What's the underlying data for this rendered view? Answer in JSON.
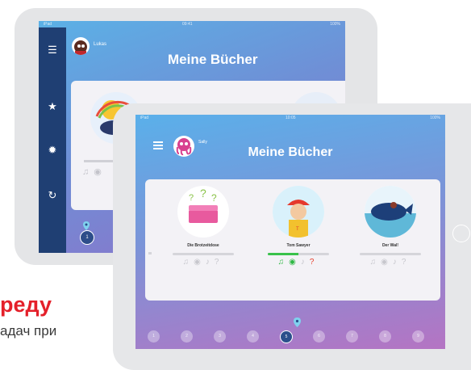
{
  "back": {
    "status_time": "09:41",
    "status_left": "iPad",
    "status_right": "100%",
    "username": "Lukas",
    "title": "Meine Bücher",
    "page_dot": "1"
  },
  "front": {
    "status_left": "iPad",
    "status_time": "10:05",
    "status_right": "100%",
    "username": "Sally",
    "title": "Meine Bücher",
    "books": [
      {
        "title": "Die Brotzeitdose",
        "progress": 0
      },
      {
        "title": "Tom Sawyer",
        "progress": 0.5
      },
      {
        "title": "Der Wal!",
        "progress": 0
      }
    ],
    "pages": [
      "1",
      "2",
      "3",
      "4",
      "5",
      "6",
      "7",
      "8",
      "9"
    ],
    "active_page": 5
  },
  "text": {
    "heading": "реду",
    "line": "адач при"
  },
  "colors": {
    "sidebar": "#1f3f73",
    "accent_green": "#2fb844",
    "accent_red": "#e8402c",
    "heading_red": "#e4202a"
  },
  "icons": [
    "menu-icon",
    "star-icon",
    "gear-icon",
    "refresh-icon",
    "headphones-icon",
    "eye-icon",
    "microphone-icon",
    "question-icon",
    "location-pin-icon"
  ]
}
